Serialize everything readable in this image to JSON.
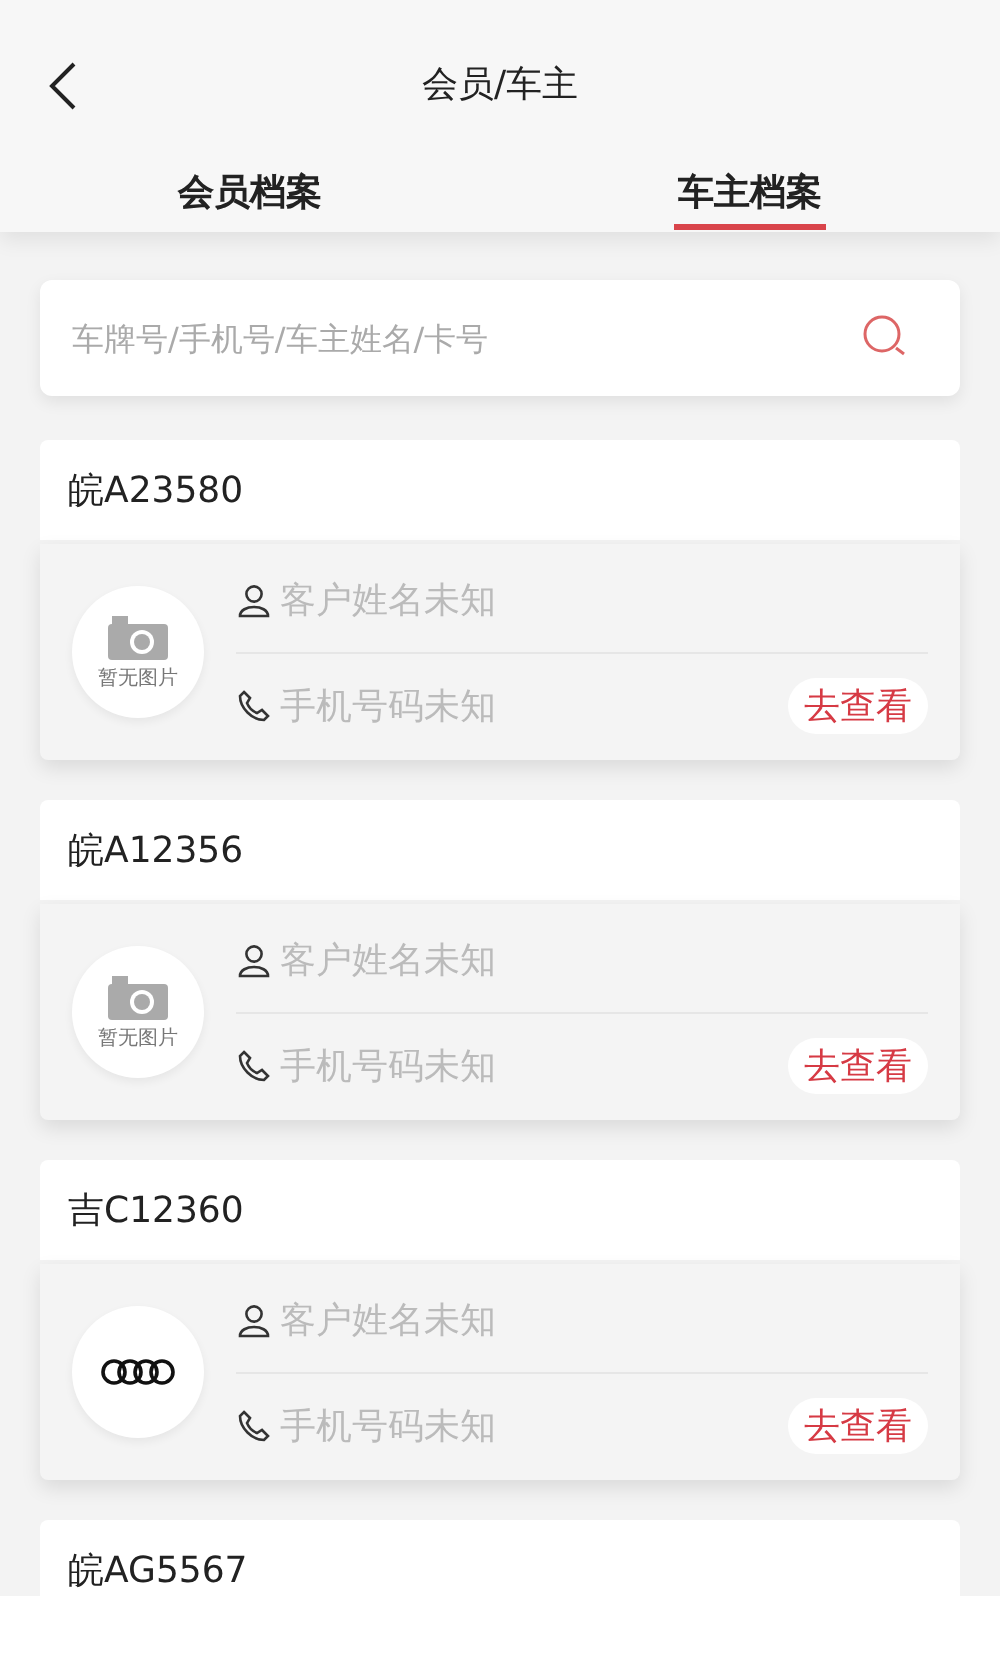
{
  "header": {
    "title": "会员/车主"
  },
  "tabs": [
    {
      "label": "会员档案",
      "selected": false
    },
    {
      "label": "车主档案",
      "selected": true
    }
  ],
  "search": {
    "placeholder": "车牌号/手机号/车主姓名/卡号"
  },
  "owners": [
    {
      "plate": "皖A23580",
      "avatar": {
        "kind": "placeholder",
        "caption": "暂无图片"
      },
      "name": "客户姓名未知",
      "phone": "手机号码未知",
      "action": "去查看"
    },
    {
      "plate": "皖A12356",
      "avatar": {
        "kind": "placeholder",
        "caption": "暂无图片"
      },
      "name": "客户姓名未知",
      "phone": "手机号码未知",
      "action": "去查看"
    },
    {
      "plate": "吉C12360",
      "avatar": {
        "kind": "logo"
      },
      "name": "客户姓名未知",
      "phone": "手机号码未知",
      "action": "去查看"
    },
    {
      "plate": "皖AG5567"
    }
  ]
}
